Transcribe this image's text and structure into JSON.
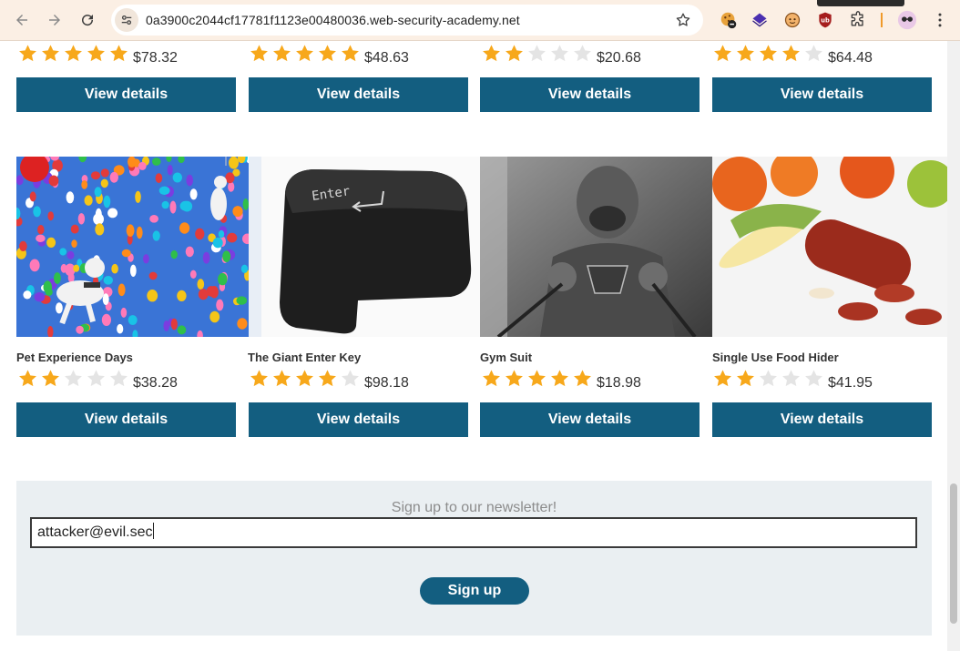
{
  "browser": {
    "url": "0a3900c2044cf17781f1123e00480036.web-security-academy.net",
    "icons": [
      "back-icon",
      "forward-icon",
      "reload-icon",
      "site-info-icon",
      "bookmark-star-icon",
      "extensions-puzzle-icon",
      "menu-kebab-icon"
    ]
  },
  "colors": {
    "button": "#135e80",
    "star_filled": "#f7a81b",
    "star_empty": "#e4e4e4",
    "newsletter_bg": "#eaeff2"
  },
  "top_row": [
    {
      "rating": 5,
      "price": "$78.32",
      "button": "View details"
    },
    {
      "rating": 5,
      "price": "$48.63",
      "button": "View details"
    },
    {
      "rating": 2,
      "price": "$20.68",
      "button": "View details"
    },
    {
      "rating": 4,
      "price": "$64.48",
      "button": "View details"
    }
  ],
  "bottom_row": [
    {
      "name": "Pet Experience Days",
      "rating": 2,
      "price": "$38.28",
      "button": "View details"
    },
    {
      "name": "The Giant Enter Key",
      "rating": 4,
      "price": "$98.18",
      "button": "View details"
    },
    {
      "name": "Gym Suit",
      "rating": 5,
      "price": "$18.98",
      "button": "View details"
    },
    {
      "name": "Single Use Food Hider",
      "rating": 2,
      "price": "$41.95",
      "button": "View details"
    }
  ],
  "newsletter": {
    "title": "Sign up to our newsletter!",
    "email_value": "attacker@evil.sec",
    "button": "Sign up"
  },
  "images": {
    "enter_key_label": "Enter"
  }
}
